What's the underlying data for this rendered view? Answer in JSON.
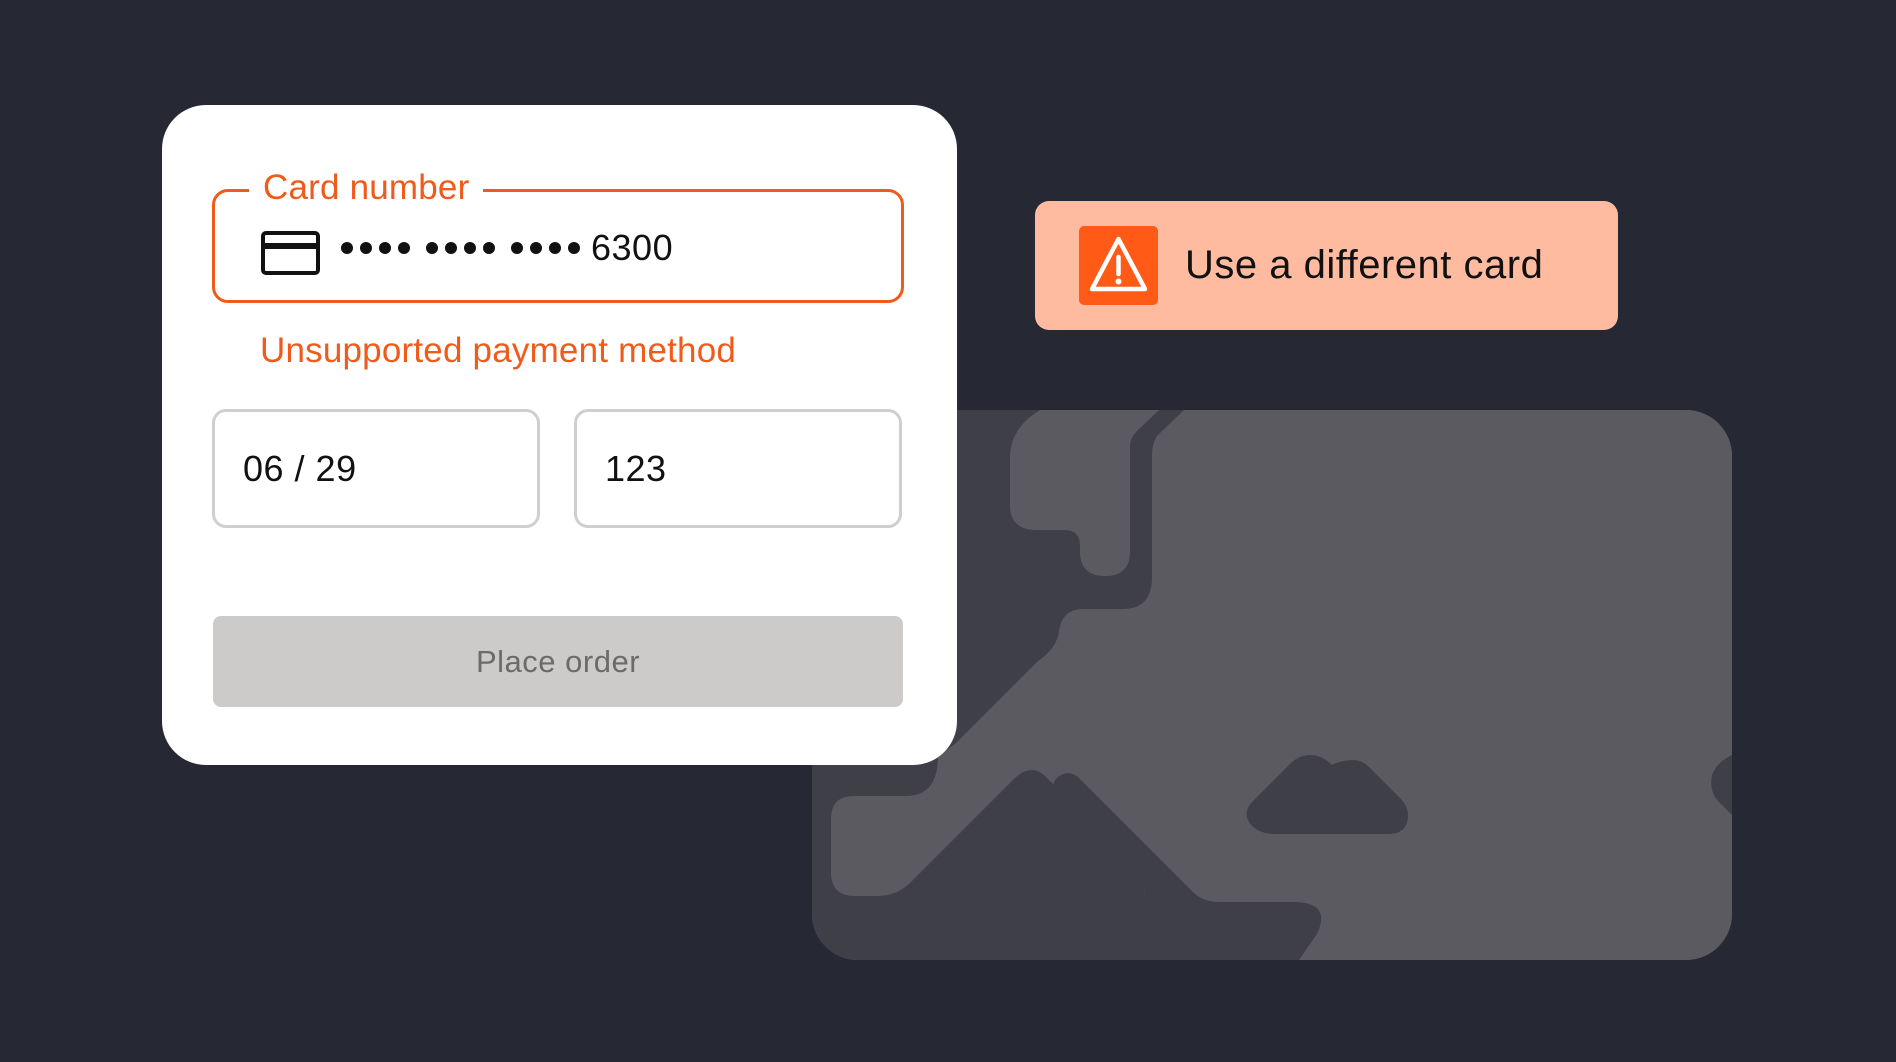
{
  "payment_form": {
    "card_number": {
      "label": "Card number",
      "last4": "6300",
      "masked_groups": 3,
      "dots_per_group": 4,
      "state": "error"
    },
    "error_message": "Unsupported payment method",
    "expiry": {
      "value": "06 / 29"
    },
    "cvc": {
      "value": "123"
    },
    "place_order": {
      "label": "Place order",
      "disabled": true
    }
  },
  "toast": {
    "icon": "warning-triangle-icon",
    "message": "Use a different card"
  },
  "illustration": {
    "icon": "europe-map-card"
  },
  "colors": {
    "background": "#262933",
    "error_accent": "#f05a1a",
    "toast_background": "#ffbba0",
    "toast_icon_background": "#ff5a16",
    "disabled_button": "#cdcaca",
    "map_land": "#5a5a60",
    "map_water": "#3f4047"
  }
}
